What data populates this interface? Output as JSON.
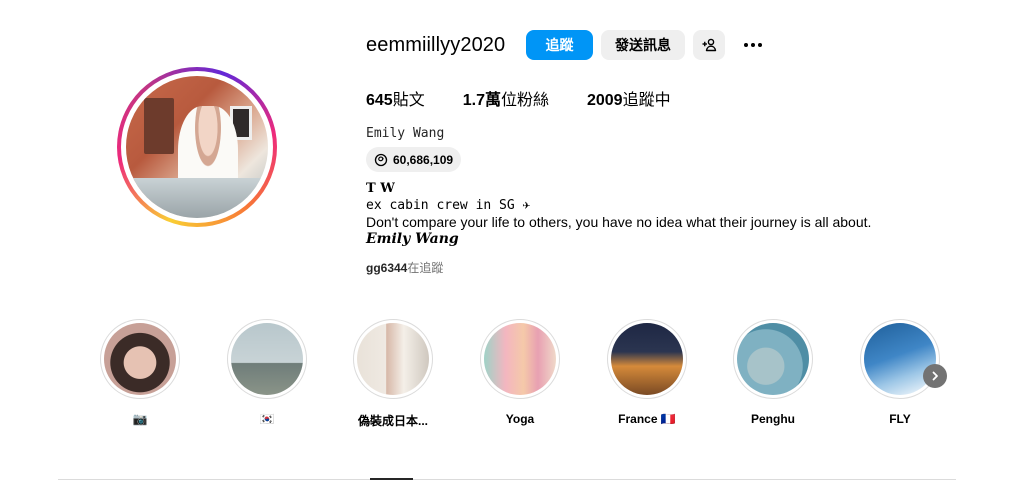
{
  "profile": {
    "username": "eemmiillyy2020",
    "full_name": "Emily Wang",
    "threads_count": "60,686,109",
    "posts_label": "645貼文",
    "followers_label": "1.7萬位粉絲",
    "following_label": "2009追蹤中"
  },
  "stats": {
    "posts_value": "645",
    "posts_unit": "貼文",
    "followers_value": "1.7萬",
    "followers_unit": "位粉絲",
    "following_value": "2009",
    "following_unit": "追蹤中"
  },
  "actions": {
    "follow_label": "追蹤",
    "message_label": "發送訊息"
  },
  "bio": {
    "line1": "T W",
    "line2": "ex cabin crew in SG ✈",
    "line3": "Don't compare your life to others, you have no idea what their journey is all about.",
    "line4": "Emily Wang"
  },
  "followed_by": {
    "user": "gg6344",
    "suffix": "在追蹤"
  },
  "highlights": [
    {
      "label": "📷"
    },
    {
      "label": "🇰🇷"
    },
    {
      "label": "偽裝成日本..."
    },
    {
      "label": "Yoga"
    },
    {
      "label": "France 🇫🇷"
    },
    {
      "label": "Penghu"
    },
    {
      "label": "FLY"
    }
  ],
  "colors": {
    "follow_button": "#0095f6",
    "secondary_button": "#efefef",
    "muted_text": "#737373"
  },
  "icons": [
    "add-user-icon",
    "more-options-icon",
    "threads-icon",
    "next-arrow-icon"
  ]
}
